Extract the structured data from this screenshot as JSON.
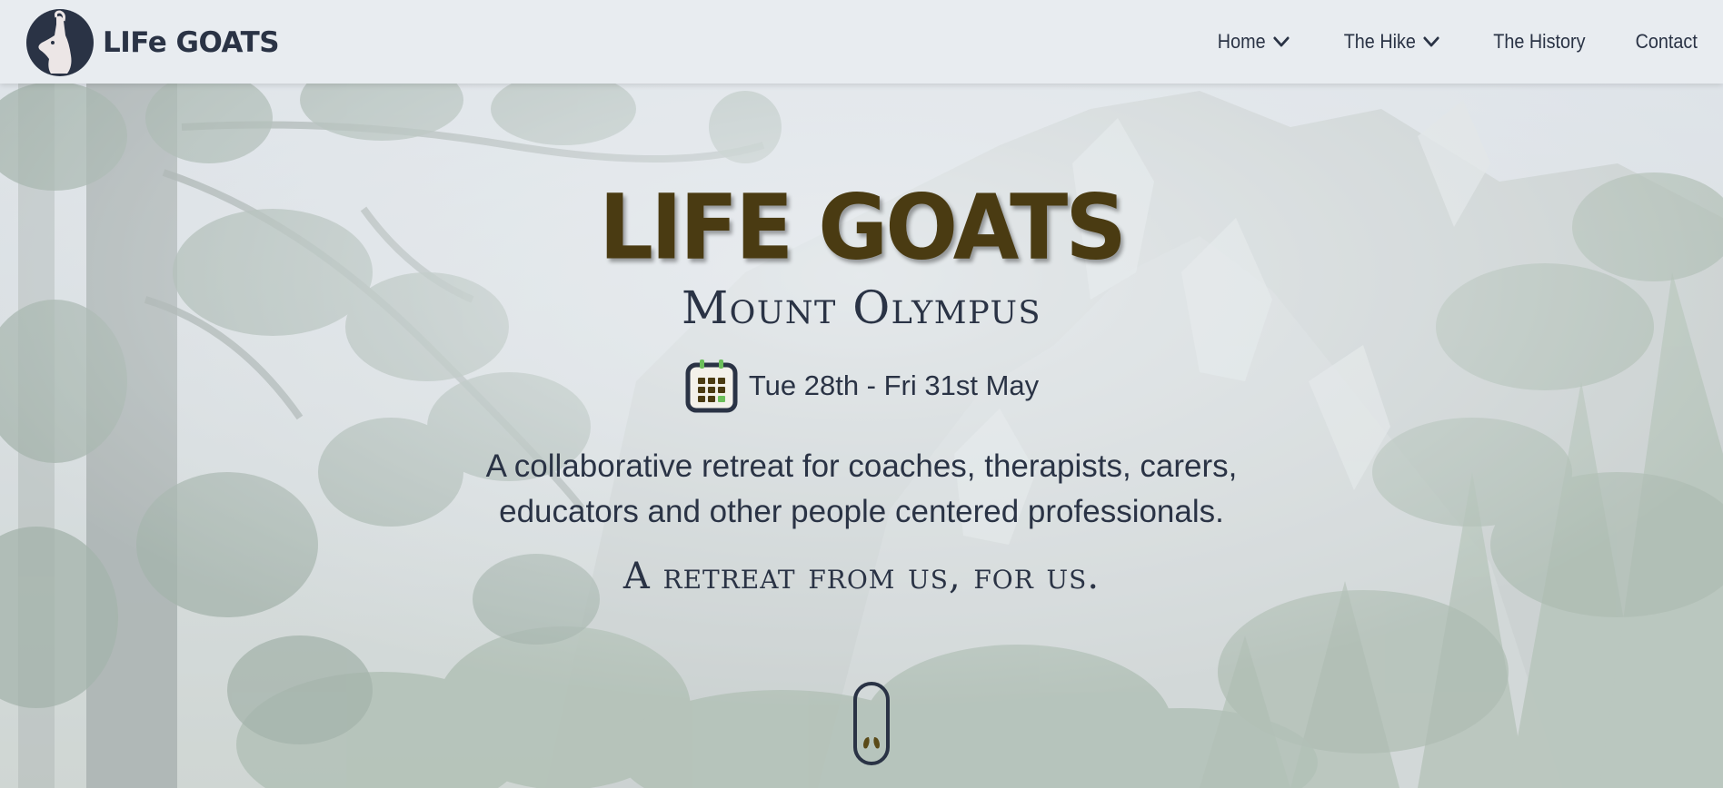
{
  "brand": {
    "name": "LIFe GOATS",
    "logo_icon": "goat-logo-icon"
  },
  "nav": {
    "items": [
      {
        "label": "Home",
        "has_dropdown": true
      },
      {
        "label": "The Hike",
        "has_dropdown": true
      },
      {
        "label": "The History",
        "has_dropdown": false
      },
      {
        "label": "Contact",
        "has_dropdown": false
      }
    ]
  },
  "hero": {
    "title": "LIFE GOATS",
    "subtitle": "Mount Olympus",
    "date_icon": "calendar-icon",
    "date": "Tue 28th - Fri 31st May",
    "tagline_line1": "A collaborative retreat for coaches, therapists, carers,",
    "tagline_line2": "educators and other people centered professionals.",
    "motto": "A retreat from us, for us.",
    "scroll_icon": "hoofprint-scroll-icon"
  },
  "colors": {
    "header_bg": "#e8ecf0",
    "text_dark": "#2a3345",
    "title_brown": "#4a3b12",
    "calendar_green": "#6cbf5a"
  }
}
